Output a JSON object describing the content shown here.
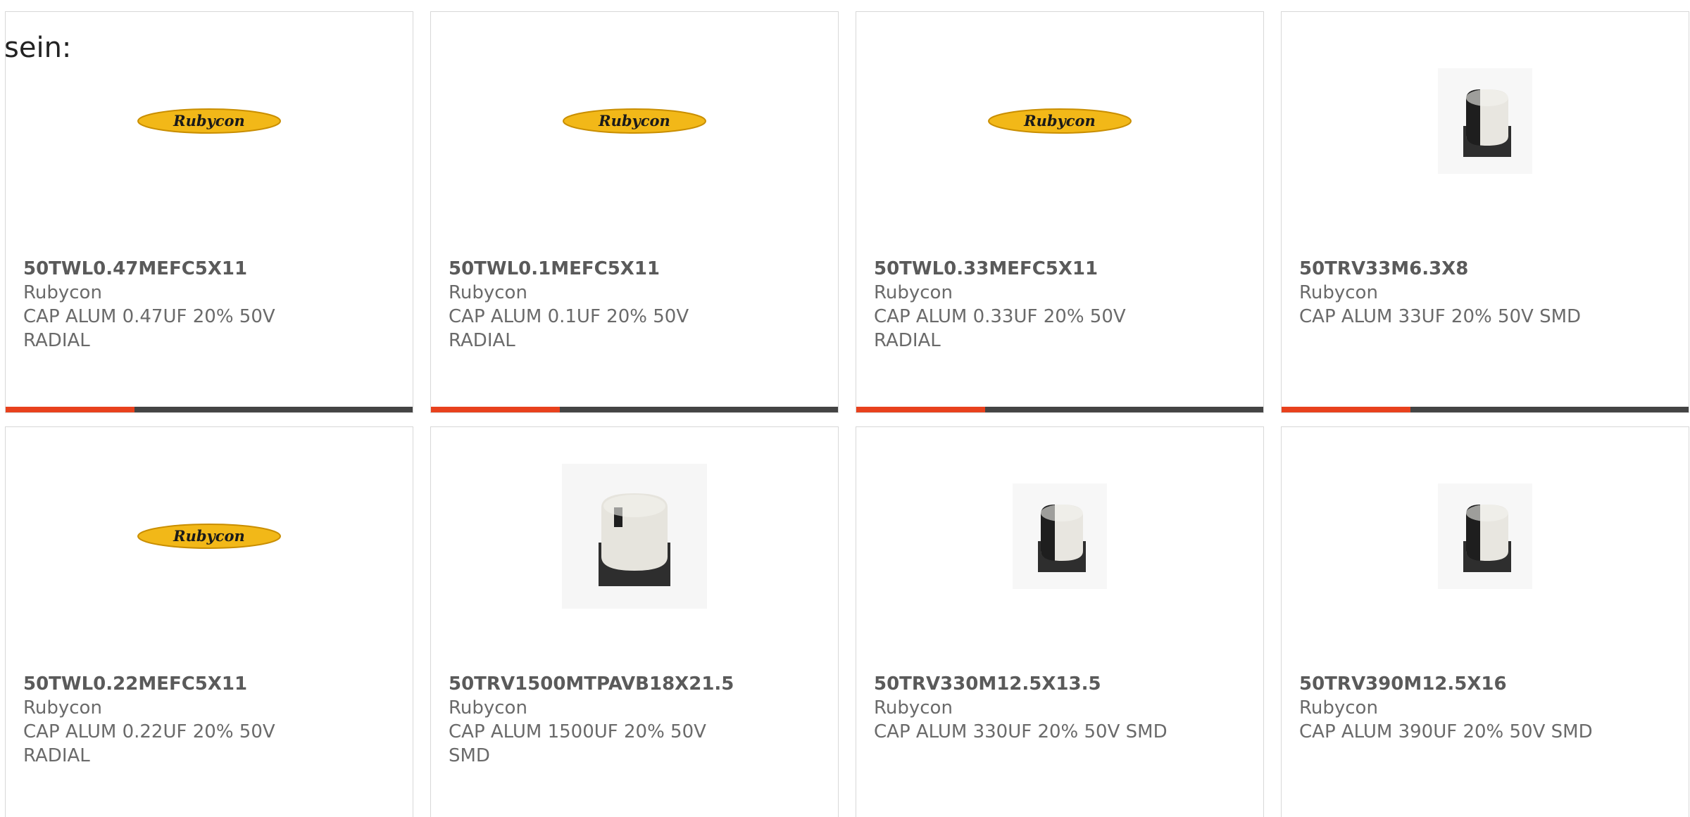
{
  "stray_text": "sein:",
  "logo_text": "Rubycon",
  "colors": {
    "accent": "#e8411d",
    "bar": "#444444",
    "logo_fill": "#f2b818"
  },
  "products": [
    {
      "part_number": "50TWL0.47MEFC5X11",
      "manufacturer": "Rubycon",
      "description": "CAP ALUM 0.47UF 20% 50V RADIAL",
      "image": "rubycon-logo"
    },
    {
      "part_number": "50TWL0.1MEFC5X11",
      "manufacturer": "Rubycon",
      "description": "CAP ALUM 0.1UF 20% 50V RADIAL",
      "image": "rubycon-logo"
    },
    {
      "part_number": "50TWL0.33MEFC5X11",
      "manufacturer": "Rubycon",
      "description": "CAP ALUM 0.33UF 20% 50V RADIAL",
      "image": "rubycon-logo"
    },
    {
      "part_number": "50TRV33M6.3X8",
      "manufacturer": "Rubycon",
      "description": "CAP ALUM 33UF 20% 50V SMD",
      "image": "smd-capacitor"
    },
    {
      "part_number": "50TWL0.22MEFC5X11",
      "manufacturer": "Rubycon",
      "description": "CAP ALUM 0.22UF 20% 50V RADIAL",
      "image": "rubycon-logo"
    },
    {
      "part_number": "50TRV1500MTPAVB18X21.5",
      "manufacturer": "Rubycon",
      "description": "CAP ALUM 1500UF 20% 50V SMD",
      "image": "smd-capacitor-large"
    },
    {
      "part_number": "50TRV330M12.5X13.5",
      "manufacturer": "Rubycon",
      "description": "CAP ALUM 330UF 20% 50V SMD",
      "image": "smd-capacitor"
    },
    {
      "part_number": "50TRV390M12.5X16",
      "manufacturer": "Rubycon",
      "description": "CAP ALUM 390UF 20% 50V SMD",
      "image": "smd-capacitor"
    }
  ]
}
